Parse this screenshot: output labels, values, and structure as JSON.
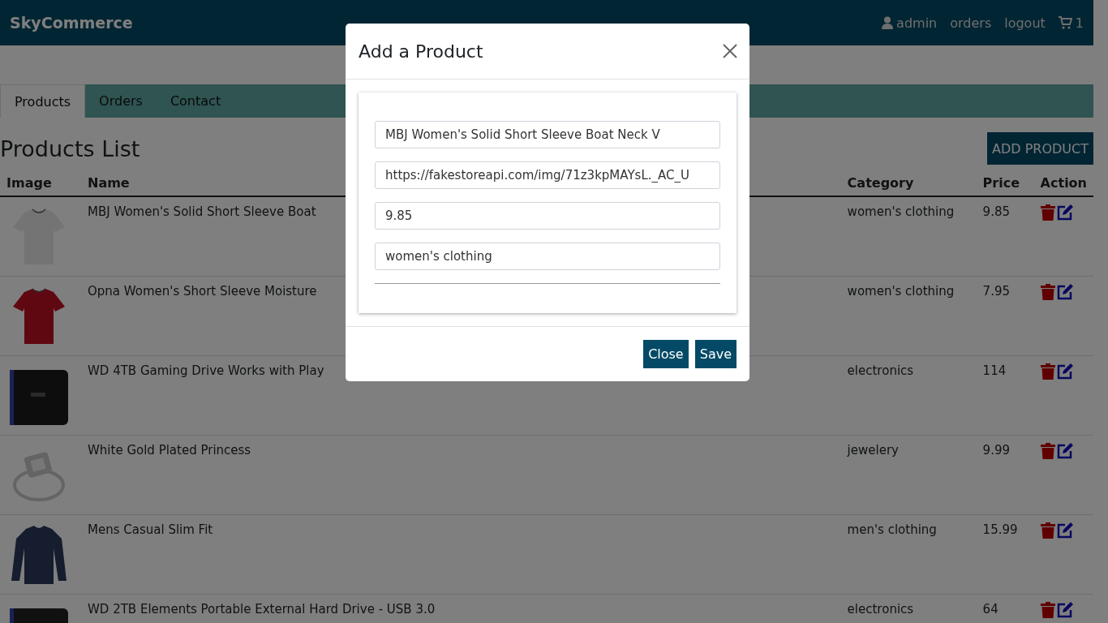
{
  "header": {
    "brand": "SkyCommerce",
    "nav": [
      {
        "kind": "user",
        "label": "admin"
      },
      {
        "kind": "link",
        "label": "orders"
      },
      {
        "kind": "link",
        "label": "logout"
      },
      {
        "kind": "cart",
        "label": "1"
      }
    ]
  },
  "tabs": [
    {
      "label": "Products",
      "selected": true
    },
    {
      "label": "Orders",
      "selected": false
    },
    {
      "label": "Contact",
      "selected": false
    }
  ],
  "page_title": "Products List",
  "add_button": "ADD PRODUCT",
  "table": {
    "columns": [
      "Image",
      "Name",
      "Category",
      "Price",
      "Action"
    ],
    "rows": [
      {
        "name": "MBJ Women's Solid Short Sleeve Boat",
        "category": "women's clothing",
        "price": "9.85"
      },
      {
        "name": "Opna Women's Short Sleeve Moisture",
        "category": "women's clothing",
        "price": "7.95"
      },
      {
        "name": "WD 4TB Gaming Drive Works with Play",
        "category": "electronics",
        "price": "114"
      },
      {
        "name": "White Gold Plated Princess",
        "category": "jewelery",
        "price": "9.99"
      },
      {
        "name": "Mens Casual Slim Fit",
        "category": "men's clothing",
        "price": "15.99"
      },
      {
        "name": "WD 2TB Elements Portable External Hard Drive - USB 3.0",
        "category": "electronics",
        "price": "64"
      }
    ]
  },
  "modal": {
    "title": "Add a Product",
    "fields": [
      {
        "value": "MBJ Women's Solid Short Sleeve Boat Neck V"
      },
      {
        "value": "https://fakestoreapi.com/img/71z3kpMAYsL._AC_U"
      },
      {
        "value": "9.85"
      },
      {
        "value": "women's clothing"
      }
    ],
    "buttons": [
      "Close",
      "Save"
    ]
  }
}
